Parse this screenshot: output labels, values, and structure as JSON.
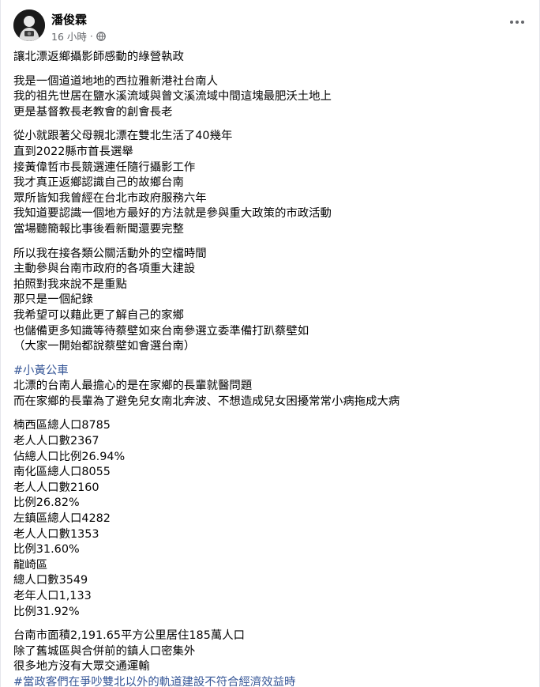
{
  "post": {
    "author": "潘俊霖",
    "time": "16 小時",
    "separator": "·",
    "audience_icon": "globe-icon",
    "more_icon": "more-options-icon"
  },
  "content": {
    "paragraphs": [
      {
        "lines": [
          {
            "text": "讓北漂返鄉攝影師感動的綠營執政"
          }
        ]
      },
      {
        "lines": [
          {
            "text": "我是一個道道地地的西拉雅新港社台南人"
          },
          {
            "text": "我的祖先世居在鹽水溪流域與曾文溪流域中間這塊最肥沃土地上"
          },
          {
            "text": "更是基督教長老教會的創會長老"
          }
        ]
      },
      {
        "lines": [
          {
            "text": "從小就跟著父母親北漂在雙北生活了40幾年"
          },
          {
            "text": "直到2022縣市首長選舉"
          },
          {
            "text": "接黃偉哲市長競選連任隨行攝影工作"
          },
          {
            "text": "我才真正返鄉認識自己的故鄉台南"
          },
          {
            "text": "眾所皆知我曾經在台北市政府服務六年"
          },
          {
            "text": "我知道要認識一個地方最好的方法就是參與重大政策的市政活動"
          },
          {
            "text": "當場聽簡報比事後看新聞還要完整"
          }
        ]
      },
      {
        "lines": [
          {
            "text": "所以我在接各類公關活動外的空檔時間"
          },
          {
            "text": "主動參與台南市政府的各項重大建設"
          },
          {
            "text": "拍照對我來說不是重點"
          },
          {
            "text": "那只是一個紀錄"
          },
          {
            "text": "我希望可以藉此更了解自己的家鄉"
          },
          {
            "text": "也儲備更多知識等待蔡壁如來台南參選立委準備打趴蔡壁如"
          },
          {
            "text": "（大家一開始都說蔡壁如會選台南）"
          }
        ]
      },
      {
        "lines": [
          {
            "text": "#小黃公車",
            "hashtag": true
          },
          {
            "text": "北漂的台南人最擔心的是在家鄉的長輩就醫問題"
          },
          {
            "text": "而在家鄉的長輩為了避免兒女南北奔波、不想造成兒女困擾常常小病拖成大病"
          }
        ]
      },
      {
        "lines": [
          {
            "text": "楠西區總人口8785"
          },
          {
            "text": "老人人口數2367"
          },
          {
            "text": "佔總人口比例26.94%"
          },
          {
            "text": "南化區總人口8055"
          },
          {
            "text": "老人人口數2160"
          },
          {
            "text": "比例26.82%"
          },
          {
            "text": "左鎮區總人口4282"
          },
          {
            "text": "老人人口數1353"
          },
          {
            "text": "比例31.60%"
          },
          {
            "text": "龍崎區"
          },
          {
            "text": "總人口數3549"
          },
          {
            "text": "老年人口1,133"
          },
          {
            "text": "比例31.92%"
          }
        ]
      },
      {
        "lines": [
          {
            "text": "台南市面積2,191.65平方公里居住185萬人口"
          },
          {
            "text": "除了舊城區與合併前的鎮人口密集外"
          },
          {
            "text": "很多地方沒有大眾交通運輸"
          },
          {
            "text": "#當政客們在爭吵雙北以外的軌道建設不符合經濟效益時",
            "hashtag": true
          }
        ]
      }
    ]
  },
  "colors": {
    "text": "#050505",
    "secondary": "#65676b",
    "hashtag": "#385898"
  }
}
